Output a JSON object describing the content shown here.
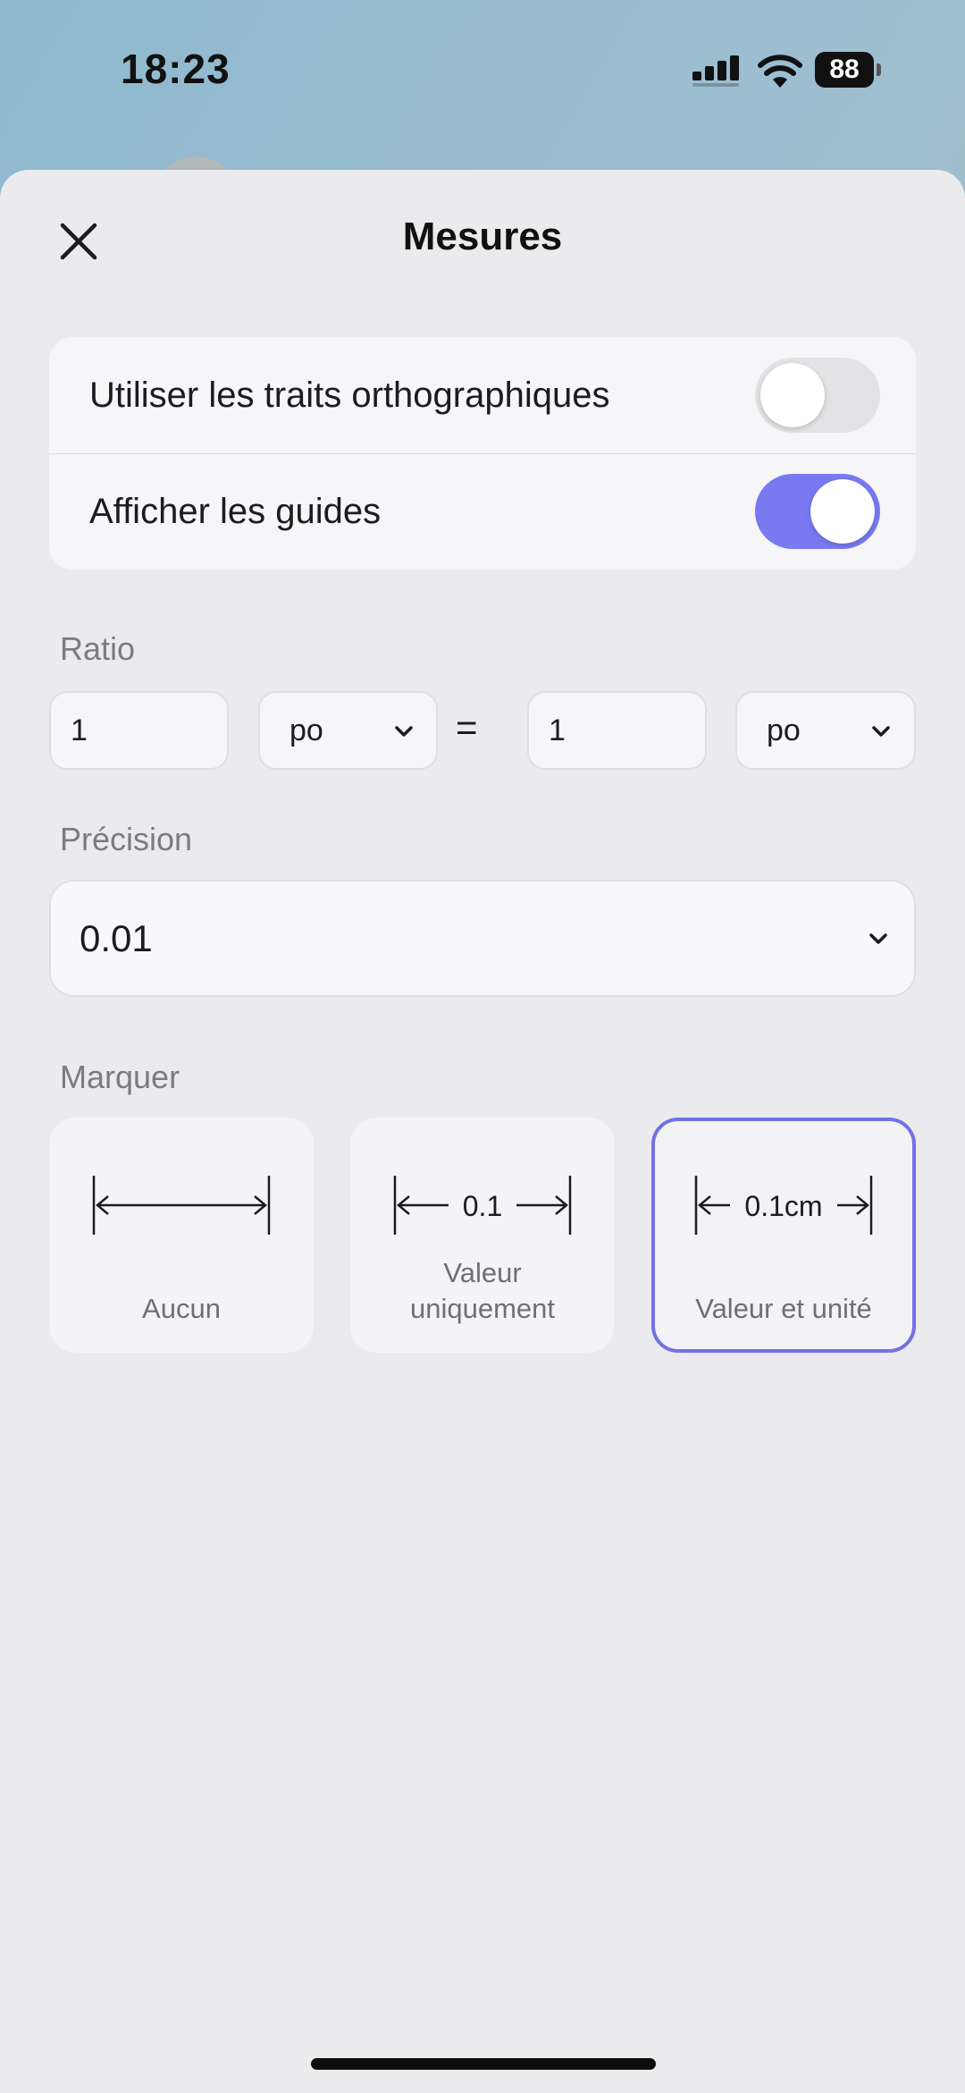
{
  "status_bar": {
    "time": "18:23",
    "battery": "88"
  },
  "sheet": {
    "title": "Mesures",
    "toggles": [
      {
        "label": "Utiliser les traits orthographiques",
        "on": false
      },
      {
        "label": "Afficher les guides",
        "on": true
      }
    ],
    "ratio": {
      "label": "Ratio",
      "left_value": "1",
      "left_unit": "po",
      "equals": "=",
      "right_value": "1",
      "right_unit": "po"
    },
    "precision": {
      "label": "Précision",
      "value": "0.01"
    },
    "marker": {
      "label": "Marquer",
      "options": [
        {
          "label": "Aucun",
          "sample": "",
          "selected": false
        },
        {
          "label_line1": "Valeur",
          "label_line2": "uniquement",
          "sample": "0.1",
          "selected": false
        },
        {
          "label": "Valeur et unité",
          "sample": "0.1cm",
          "selected": true
        }
      ]
    }
  },
  "colors": {
    "accent": "#7a79f2",
    "selected_border": "#7371e8"
  }
}
